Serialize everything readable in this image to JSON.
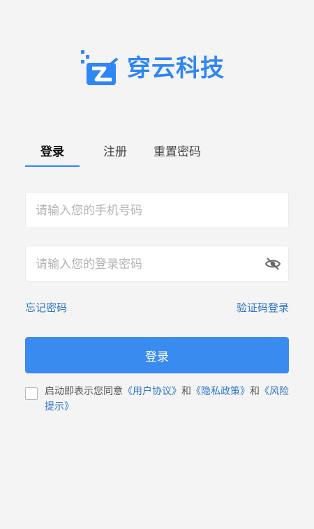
{
  "brand": {
    "name": "穿云科技",
    "color": "#2f86f6",
    "logo": "cy-logo-icon"
  },
  "tabs": [
    {
      "label": "登录",
      "active": true
    },
    {
      "label": "注册",
      "active": false
    },
    {
      "label": "重置密码",
      "active": false
    }
  ],
  "form": {
    "phone": {
      "placeholder": "请输入您的手机号码",
      "value": ""
    },
    "password": {
      "placeholder": "请输入您的登录密码",
      "value": "",
      "toggle_icon": "eye-off-icon"
    }
  },
  "links": {
    "forgot": "忘记密码",
    "sms_login": "验证码登录"
  },
  "submit": {
    "label": "登录",
    "color": "#3a8bf0"
  },
  "agreement": {
    "checked": false,
    "prefix": "启动即表示您同意",
    "user_agreement": "《用户协议》",
    "and1": "和",
    "privacy_policy": "《隐私政策》",
    "and2": "和",
    "risk_notice": "《风险提示》"
  }
}
